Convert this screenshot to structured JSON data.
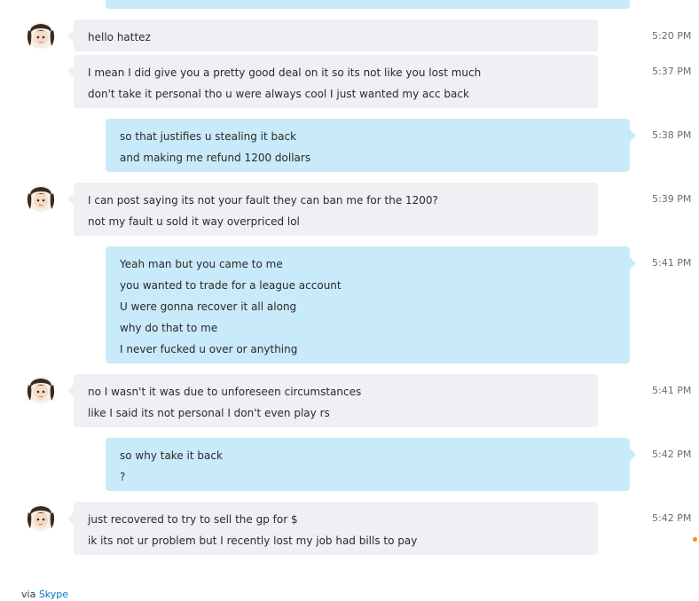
{
  "colors": {
    "them_bubble": "#eef0f4",
    "me_bubble": "#c9eaf9",
    "link": "#0078c8",
    "status_dot": "#ff8c00"
  },
  "messages": [
    {
      "sender": "them",
      "time": "5:20 PM",
      "lines": [
        "hello hattez"
      ]
    },
    {
      "sender": "them",
      "time": "5:37 PM",
      "lines": [
        "I mean I did give you a pretty good deal on it so its not like you lost much",
        "don't take it personal tho u were always cool I just wanted my acc back"
      ]
    },
    {
      "sender": "me",
      "time": "5:38 PM",
      "lines": [
        "so that justifies u stealing it back",
        "and making me refund 1200 dollars"
      ]
    },
    {
      "sender": "them",
      "time": "5:39 PM",
      "lines": [
        "I can post saying its not your fault they can ban me for the 1200?",
        "not my fault u sold it way overpriced lol"
      ]
    },
    {
      "sender": "me",
      "time": "5:41 PM",
      "lines": [
        "Yeah man but you came to me",
        "you wanted to trade for a league account",
        "U were gonna recover it all along",
        "why do that to me",
        "I never fucked u over or anything"
      ]
    },
    {
      "sender": "them",
      "time": "5:41 PM",
      "lines": [
        "no I wasn't it was due to unforeseen circumstances",
        "like I said its not personal I don't even play rs"
      ]
    },
    {
      "sender": "me",
      "time": "5:42 PM",
      "lines": [
        "so why take it back",
        "?"
      ]
    },
    {
      "sender": "them",
      "time": "5:42 PM",
      "lines": [
        "just recovered to try to sell the gp for $",
        "ik its not ur problem but I recently lost my job had bills to pay"
      ]
    }
  ],
  "footer": {
    "via": "via",
    "link": "Skype"
  }
}
